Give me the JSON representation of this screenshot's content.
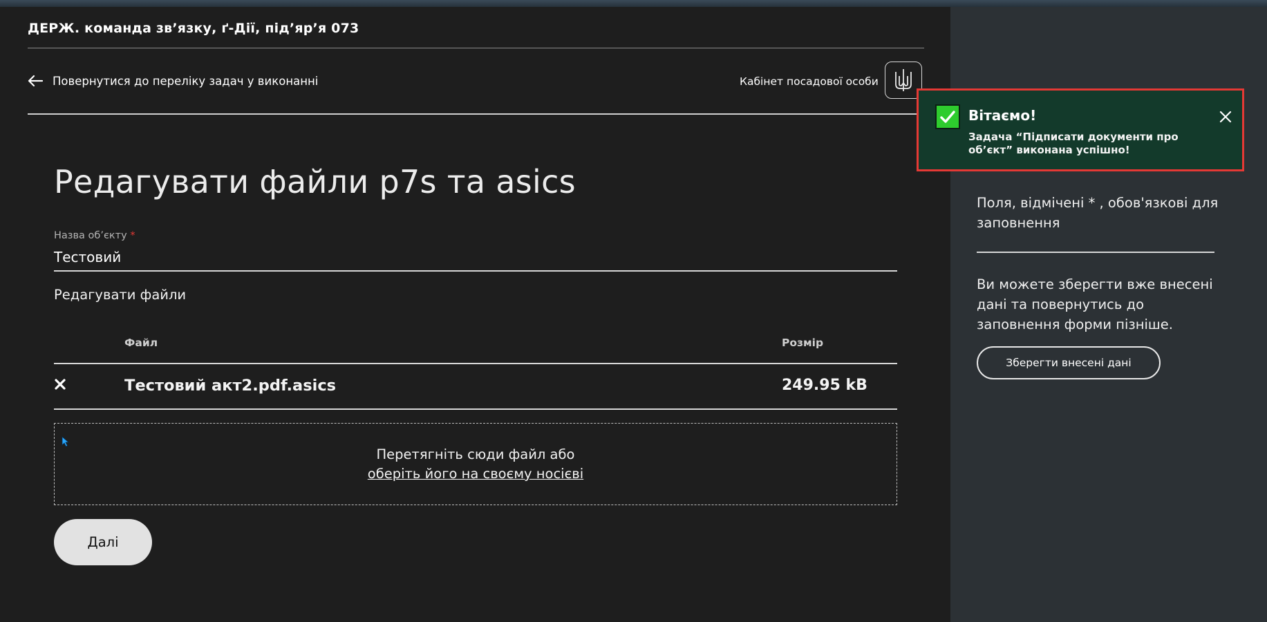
{
  "header": {
    "org_title": "ДЕРЖ. команда зв’язку, ґ-Дії, під’яр’я 073",
    "back_link": "Повернутися до переліку задач у виконанні",
    "cabinet": "Кабінет посадової особи"
  },
  "main": {
    "heading": "Редагувати файли p7s та asics",
    "object_field": {
      "label": "Назва об’єкту",
      "required_mark": "*",
      "value": "Тестовий"
    },
    "files_section": {
      "label": "Редагувати файли",
      "columns": {
        "file": "Файл",
        "size": "Розмір"
      },
      "rows": [
        {
          "name": "Тестовий акт2.pdf.asics",
          "size": "249.95 kB"
        }
      ]
    },
    "dropzone": {
      "text": "Перетягніть сюди файл або",
      "link": "оберіть його на своєму носієві"
    },
    "next_button": "Далі"
  },
  "sidebar": {
    "required_note": "Поля, відмічені * , обов'язкові для заповнення",
    "save_note": "Ви можете зберегти вже внесені дані та повернутись до заповнення форми пізніше.",
    "save_button": "Зберегти внесені дані"
  },
  "toast": {
    "title": "Вітаємо!",
    "message": "Задача “Підписати документи про об’єкт” виконана успішно!"
  },
  "colors": {
    "toast_bg": "#133a2b",
    "toast_border": "#e53935",
    "check_green": "#2ecc2e",
    "required_red": "#e53935"
  },
  "icons": [
    "arrow-left-icon",
    "trident-emblem-icon",
    "remove-x-icon",
    "mouse-cursor-icon",
    "checkmark-icon",
    "close-icon"
  ]
}
